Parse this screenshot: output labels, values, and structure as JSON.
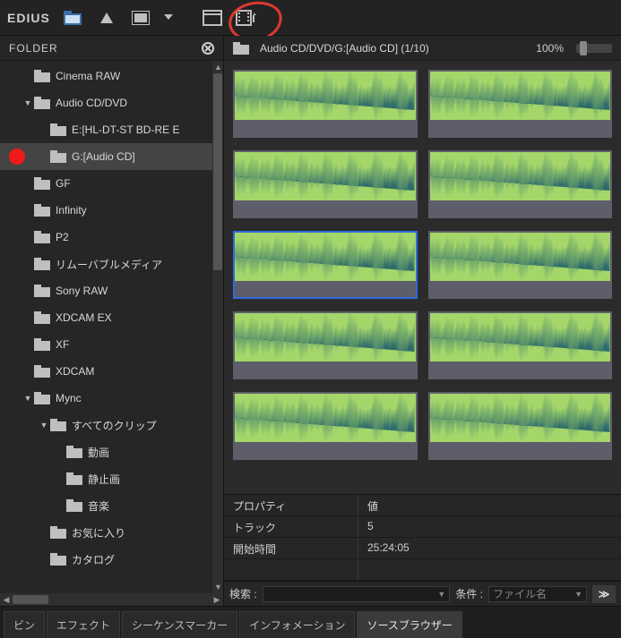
{
  "app_name": "EDIUS",
  "toolbar": {
    "icons": [
      "folder-open-icon",
      "up-triangle-icon",
      "layout-icon",
      "chevron-down-small",
      "window-icon",
      "film-register-icon"
    ]
  },
  "folder_panel": {
    "title": "FOLDER"
  },
  "tree": [
    {
      "indent": 1,
      "arrow": "",
      "label": "Cinema RAW"
    },
    {
      "indent": 1,
      "arrow": "▼",
      "label": "Audio CD/DVD"
    },
    {
      "indent": 2,
      "arrow": "",
      "label": "E:[HL-DT-ST BD-RE  E"
    },
    {
      "indent": 2,
      "arrow": "",
      "label": "G:[Audio CD]",
      "selected": true,
      "reddot": true
    },
    {
      "indent": 1,
      "arrow": "",
      "label": "GF"
    },
    {
      "indent": 1,
      "arrow": "",
      "label": "Infinity"
    },
    {
      "indent": 1,
      "arrow": "",
      "label": "P2"
    },
    {
      "indent": 1,
      "arrow": "",
      "label": "リムーバブルメディア"
    },
    {
      "indent": 1,
      "arrow": "",
      "label": "Sony RAW"
    },
    {
      "indent": 1,
      "arrow": "",
      "label": "XDCAM EX"
    },
    {
      "indent": 1,
      "arrow": "",
      "label": "XF"
    },
    {
      "indent": 1,
      "arrow": "",
      "label": "XDCAM"
    },
    {
      "indent": 1,
      "arrow": "▼",
      "label": "Mync"
    },
    {
      "indent": 2,
      "arrow": "▼",
      "label": "すべてのクリップ"
    },
    {
      "indent": 3,
      "arrow": "",
      "label": "動画"
    },
    {
      "indent": 3,
      "arrow": "",
      "label": "静止画"
    },
    {
      "indent": 3,
      "arrow": "",
      "label": "音楽"
    },
    {
      "indent": 2,
      "arrow": "",
      "label": "お気に入り"
    },
    {
      "indent": 2,
      "arrow": "",
      "label": "カタログ"
    }
  ],
  "path": {
    "text": "Audio CD/DVD/G:[Audio CD] (1/10)",
    "zoom": "100%"
  },
  "clips": [
    {
      "selected": false
    },
    {
      "selected": false
    },
    {
      "selected": false
    },
    {
      "selected": false
    },
    {
      "selected": true
    },
    {
      "selected": false
    },
    {
      "selected": false
    },
    {
      "selected": false
    },
    {
      "selected": false
    },
    {
      "selected": false
    }
  ],
  "properties": {
    "head_prop": "プロパティ",
    "head_val": "値",
    "rows": [
      {
        "k": "トラック",
        "v": "5"
      },
      {
        "k": "開始時間",
        "v": "25:24:05"
      }
    ]
  },
  "search": {
    "label": "検索 :",
    "cond_label": "条件 :",
    "cond_value": "ファイル名",
    "go": "≫"
  },
  "tabs": [
    "ビン",
    "エフェクト",
    "シーケンスマーカー",
    "インフォメーション",
    "ソースブラウザー"
  ],
  "active_tab": 4
}
